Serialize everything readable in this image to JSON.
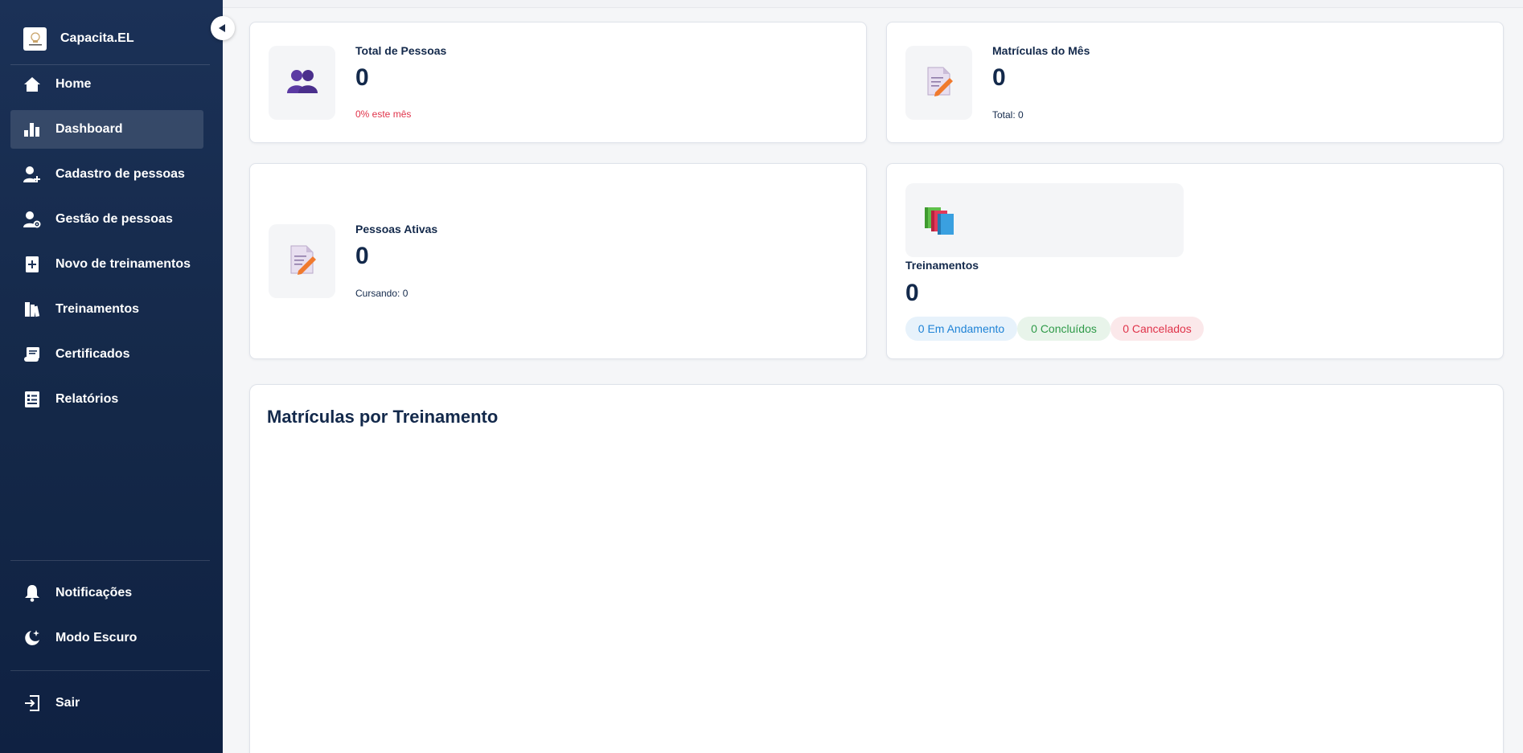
{
  "brand": {
    "name": "Capacita.EL"
  },
  "sidebar": {
    "items": [
      {
        "label": "Home",
        "icon": "home-icon"
      },
      {
        "label": "Dashboard",
        "icon": "bar-chart-icon",
        "active": true
      },
      {
        "label": "Cadastro de pessoas",
        "icon": "person-add-icon"
      },
      {
        "label": "Gestão de pessoas",
        "icon": "person-gear-icon"
      },
      {
        "label": "Novo de treinamentos",
        "icon": "add-document-icon"
      },
      {
        "label": "Treinamentos",
        "icon": "books-icon"
      },
      {
        "label": "Certificados",
        "icon": "certificate-icon"
      },
      {
        "label": "Relatórios",
        "icon": "report-icon"
      }
    ],
    "bottom_items": [
      {
        "label": "Notificações",
        "icon": "bell-icon"
      },
      {
        "label": "Modo Escuro",
        "icon": "moon-icon"
      }
    ],
    "logout": {
      "label": "Sair",
      "icon": "logout-icon"
    }
  },
  "stats": {
    "total_pessoas": {
      "title": "Total de Pessoas",
      "value": "0",
      "sub": "0% este mês",
      "icon": "people-icon"
    },
    "matriculas_mes": {
      "title": "Matrículas do Mês",
      "value": "0",
      "sub": "Total: 0",
      "icon": "memo-icon"
    },
    "pessoas_ativas": {
      "title": "Pessoas Ativas",
      "value": "0",
      "sub": "Cursando: 0",
      "icon": "memo-icon"
    },
    "treinamentos": {
      "title": "Treinamentos",
      "value": "0",
      "icon": "books-icon",
      "badges": {
        "andamento": "0 Em Andamento",
        "concluidos": "0 Concluídos",
        "cancelados": "0 Cancelados"
      }
    }
  },
  "chart": {
    "title": "Matrículas por Treinamento"
  },
  "colors": {
    "sidebar_bg": "#1b3157",
    "primary_text": "#13294b",
    "negative": "#e0334a",
    "positive": "#2e9a48",
    "info": "#1f83d6"
  }
}
